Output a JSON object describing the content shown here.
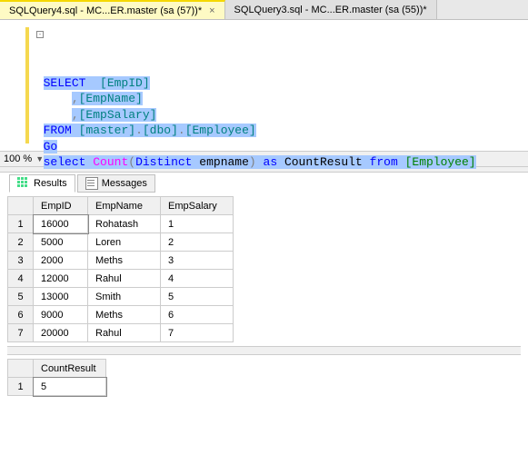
{
  "tabs": {
    "active": "SQLQuery4.sql - MC...ER.master (sa (57))*",
    "other": "SQLQuery3.sql - MC...ER.master (sa (55))*"
  },
  "sql": {
    "l1a": "SELECT",
    "l1b": "[EmpID]",
    "l2": "[EmpName]",
    "l3": "[EmpSalary]",
    "l4a": "FROM",
    "l4b": "[master]",
    "l4c": "[dbo]",
    "l4d": "[Employee]",
    "l5": "Go",
    "l6_sel": "select",
    "l6_count": "Count",
    "l6_lp": "(",
    "l6_dist": "Distinct",
    "l6_col": " empname",
    "l6_rp": ")",
    "l6_as": "as",
    "l6_alias": " CountResult ",
    "l6_from": "from",
    "l6_tbl": "[Employee]",
    "comma": ",",
    "dot": "."
  },
  "zoom": "100 %",
  "result_tabs": {
    "results": "Results",
    "messages": "Messages"
  },
  "headers": {
    "empid": "EmpID",
    "empname": "EmpName",
    "empsal": "EmpSalary",
    "countres": "CountResult"
  },
  "rows": [
    {
      "n": "1",
      "id": "16000",
      "name": "Rohatash",
      "sal": "1"
    },
    {
      "n": "2",
      "id": "5000",
      "name": "Loren",
      "sal": "2"
    },
    {
      "n": "3",
      "id": "2000",
      "name": "Meths",
      "sal": "3"
    },
    {
      "n": "4",
      "id": "12000",
      "name": "Rahul",
      "sal": "4"
    },
    {
      "n": "5",
      "id": "13000",
      "name": "Smith",
      "sal": "5"
    },
    {
      "n": "6",
      "id": "9000",
      "name": "Meths",
      "sal": "6"
    },
    {
      "n": "7",
      "id": "20000",
      "name": "Rahul",
      "sal": "7"
    }
  ],
  "count_row": {
    "n": "1",
    "val": "5"
  }
}
